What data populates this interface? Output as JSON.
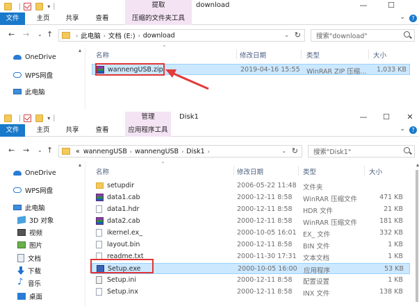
{
  "colors": {
    "file_tab": "#1979ca",
    "context_tab": "#f3e3f3",
    "selection": "#cce8ff",
    "highlight": "#e03636",
    "header_text": "#4d6082"
  },
  "window1": {
    "context_tab": "提取",
    "title": "download",
    "ribbon_tabs": [
      "文件",
      "主页",
      "共享",
      "查看",
      "压缩的文件夹工具"
    ],
    "breadcrumb": [
      "此电脑",
      "文档 (E:)",
      "download"
    ],
    "search_placeholder": "搜索\"download\"",
    "nav": [
      "OneDrive",
      "WPS网盘",
      "此电脑"
    ],
    "headers": {
      "name": "名称",
      "date": "修改日期",
      "type": "类型",
      "size": "大小"
    },
    "rows": [
      {
        "name": "wannengUSB.zip",
        "date": "2019-04-16 15:55",
        "type": "WinRAR ZIP 压缩...",
        "size": "1,033 KB",
        "icon": "rar-icon"
      }
    ]
  },
  "window2": {
    "context_tab": "管理",
    "title": "Disk1",
    "ribbon_tabs": [
      "文件",
      "主页",
      "共享",
      "查看",
      "应用程序工具"
    ],
    "breadcrumb": [
      "wannengUSB",
      "wannengUSB",
      "Disk1"
    ],
    "breadcrumb_overflow": "«",
    "search_placeholder": "搜索\"Disk1\"",
    "nav": [
      "OneDrive",
      "WPS网盘",
      "此电脑",
      "3D 对象",
      "视频",
      "图片",
      "文档",
      "下载",
      "音乐",
      "桌面"
    ],
    "headers": {
      "name": "名称",
      "date": "修改日期",
      "type": "类型",
      "size": "大小"
    },
    "rows": [
      {
        "name": "setupdir",
        "date": "2006-05-22 11:48",
        "type": "文件夹",
        "size": "",
        "icon": "folder-icon"
      },
      {
        "name": "data1.cab",
        "date": "2000-12-11 8:58",
        "type": "WinRAR 压缩文件",
        "size": "471 KB",
        "icon": "rar-icon"
      },
      {
        "name": "data1.hdr",
        "date": "2000-12-11 8:58",
        "type": "HDR 文件",
        "size": "21 KB",
        "icon": "file-icon"
      },
      {
        "name": "data2.cab",
        "date": "2000-12-11 8:58",
        "type": "WinRAR 压缩文件",
        "size": "181 KB",
        "icon": "rar-icon"
      },
      {
        "name": "ikernel.ex_",
        "date": "2000-10-05 16:01",
        "type": "EX_ 文件",
        "size": "332 KB",
        "icon": "file-icon"
      },
      {
        "name": "layout.bin",
        "date": "2000-12-11 8:58",
        "type": "BIN 文件",
        "size": "1 KB",
        "icon": "file-icon"
      },
      {
        "name": "readme.txt",
        "date": "2000-11-30 17:31",
        "type": "文本文档",
        "size": "1 KB",
        "icon": "file-icon"
      },
      {
        "name": "Setup.exe",
        "date": "2000-10-05 16:00",
        "type": "应用程序",
        "size": "53 KB",
        "icon": "exe-icon"
      },
      {
        "name": "Setup.ini",
        "date": "2000-12-11 8:58",
        "type": "配置设置",
        "size": "1 KB",
        "icon": "ini-icon"
      },
      {
        "name": "Setup.inx",
        "date": "2000-12-11 8:58",
        "type": "INX 文件",
        "size": "138 KB",
        "icon": "file-icon"
      }
    ]
  }
}
